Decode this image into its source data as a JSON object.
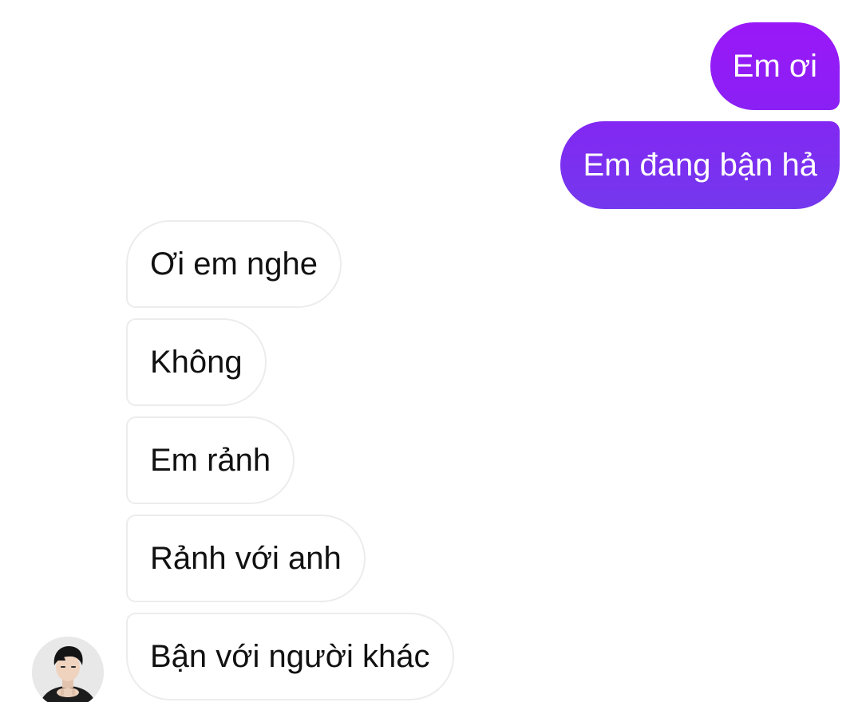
{
  "conversation": {
    "sent": [
      {
        "text": "Em ơi"
      },
      {
        "text": "Em đang bận hả"
      }
    ],
    "received": [
      {
        "text": "Ơi em nghe"
      },
      {
        "text": "Không"
      },
      {
        "text": "Em rảnh"
      },
      {
        "text": "Rảnh với anh"
      },
      {
        "text": "Bận với người khác"
      }
    ]
  },
  "colors": {
    "sent_bubble_top": "#9a18f8",
    "sent_bubble_bottom": "#7438ee",
    "received_bubble_border": "#ececec",
    "background": "#ffffff"
  },
  "icons": {
    "contact_avatar": "avatar-photo"
  }
}
